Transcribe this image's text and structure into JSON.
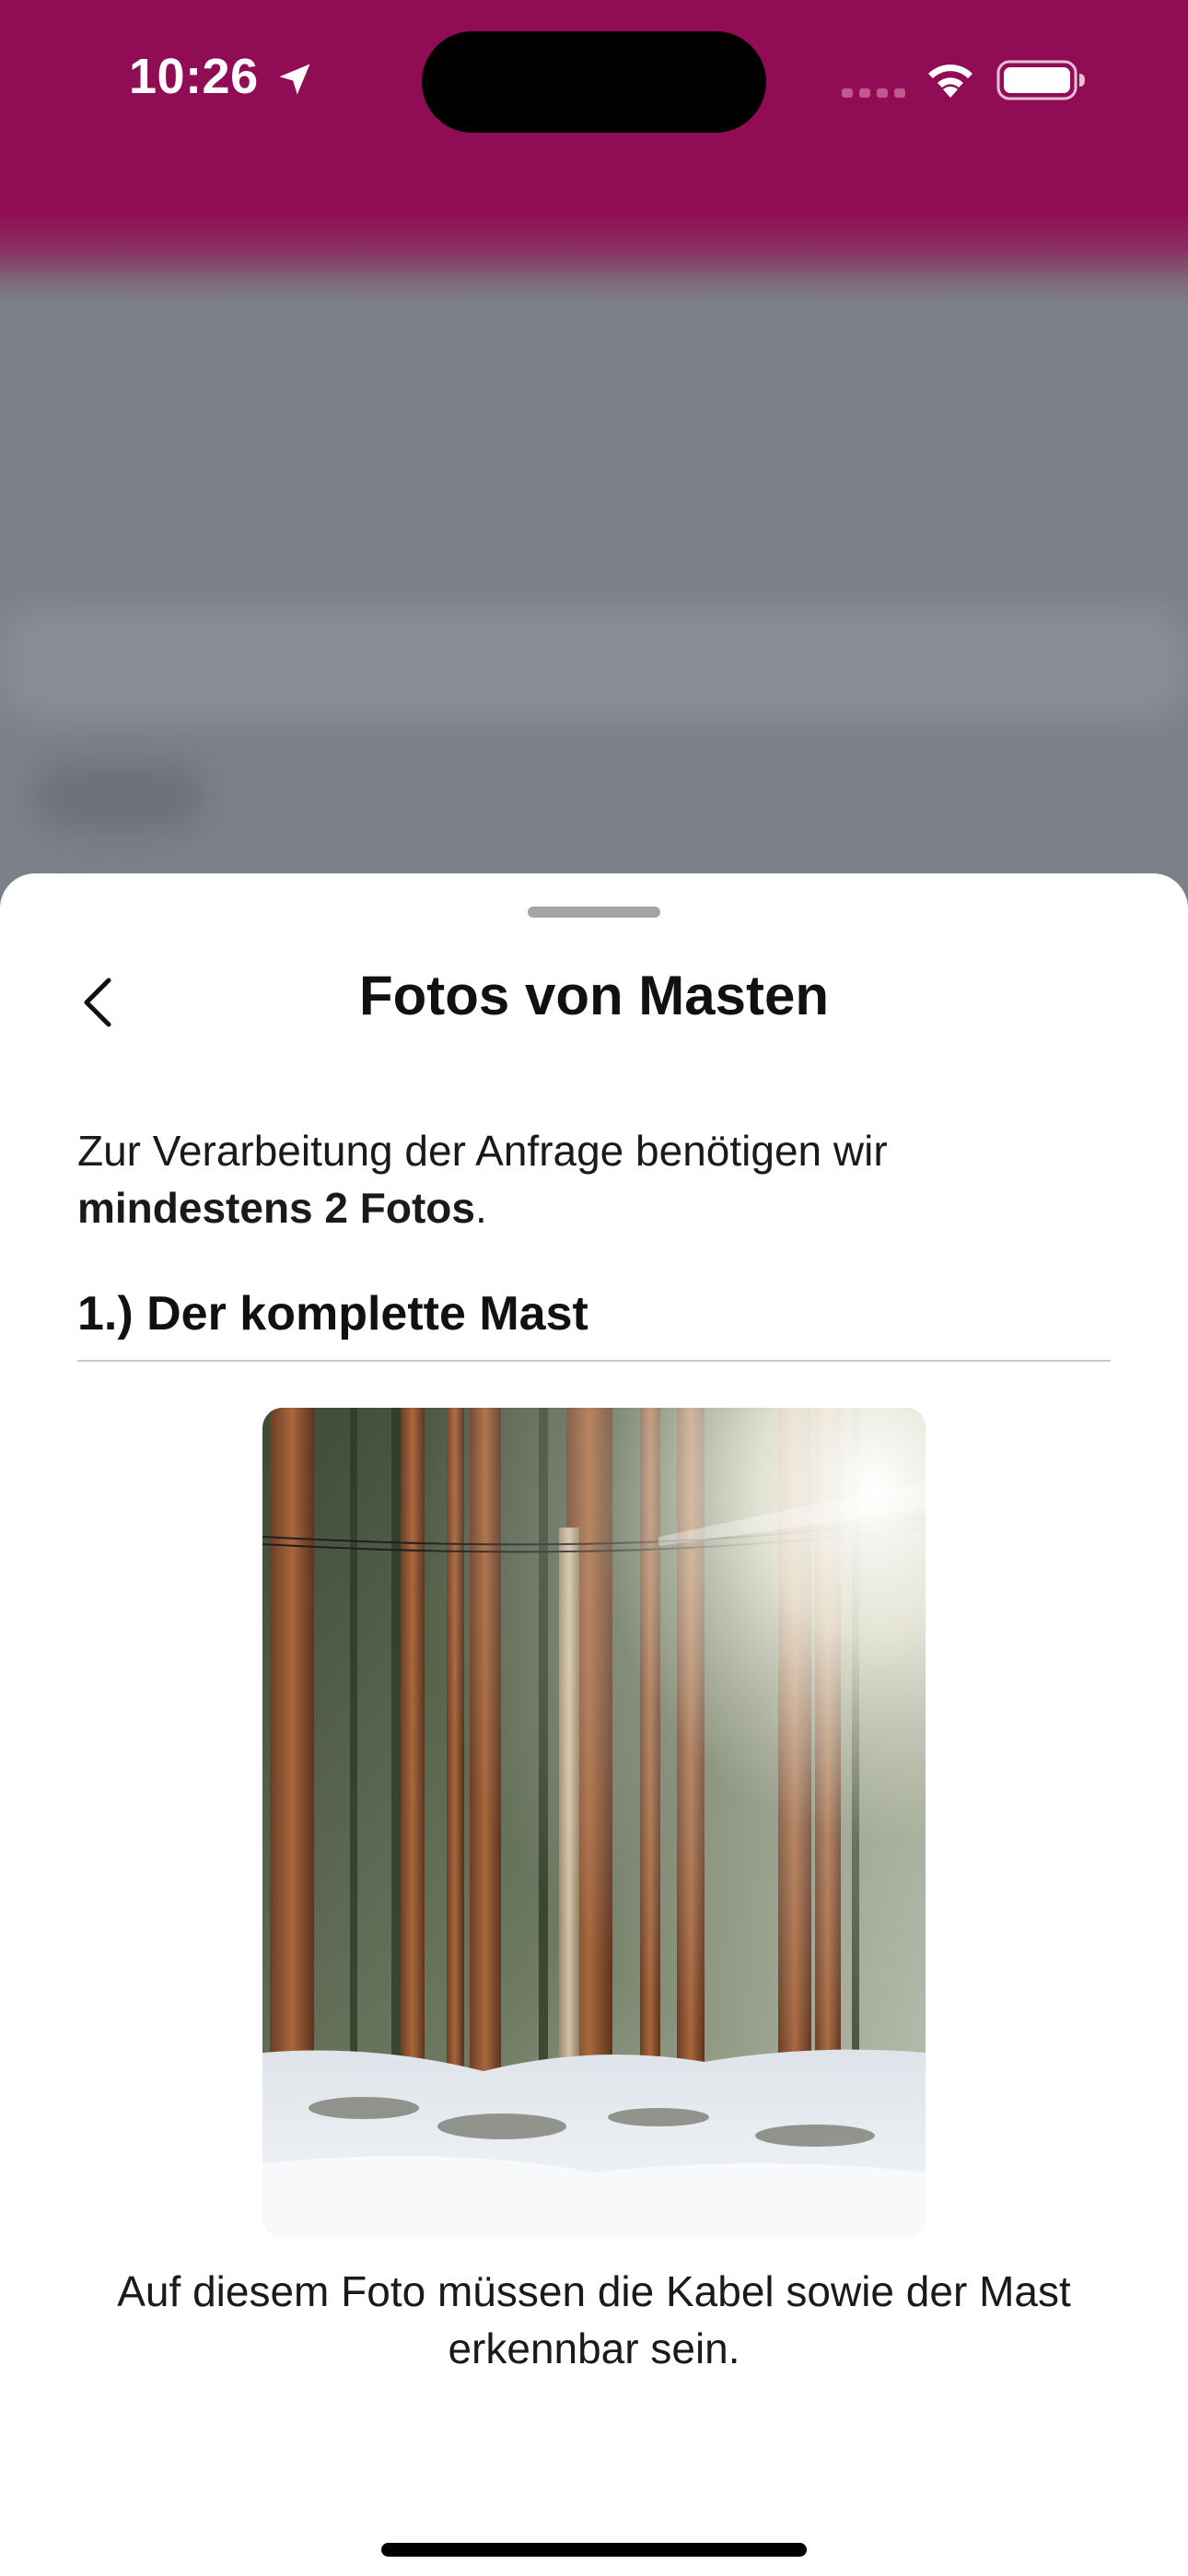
{
  "status_bar": {
    "time": "10:26"
  },
  "sheet": {
    "title": "Fotos von Masten",
    "intro_text": "Zur Verarbeitung der Anfrage benötigen wir ",
    "intro_bold": "mindestens 2 Fotos",
    "intro_end": ".",
    "section_heading": "1.) Der komplette Mast",
    "photo_alt": "Beispielfoto eines Holzmastes im verschneiten Wald",
    "caption": "Auf diesem Foto müssen die Kabel sowie der Mast erkennbar sein."
  },
  "icons": {
    "back": "chevron-left-icon",
    "location": "location-arrow-icon",
    "wifi": "wifi-icon",
    "battery": "battery-icon",
    "signal": "cellular-signal-icon"
  },
  "colors": {
    "brand_magenta": "#900d55",
    "sheet_background": "#ffffff",
    "text": "#111111"
  }
}
